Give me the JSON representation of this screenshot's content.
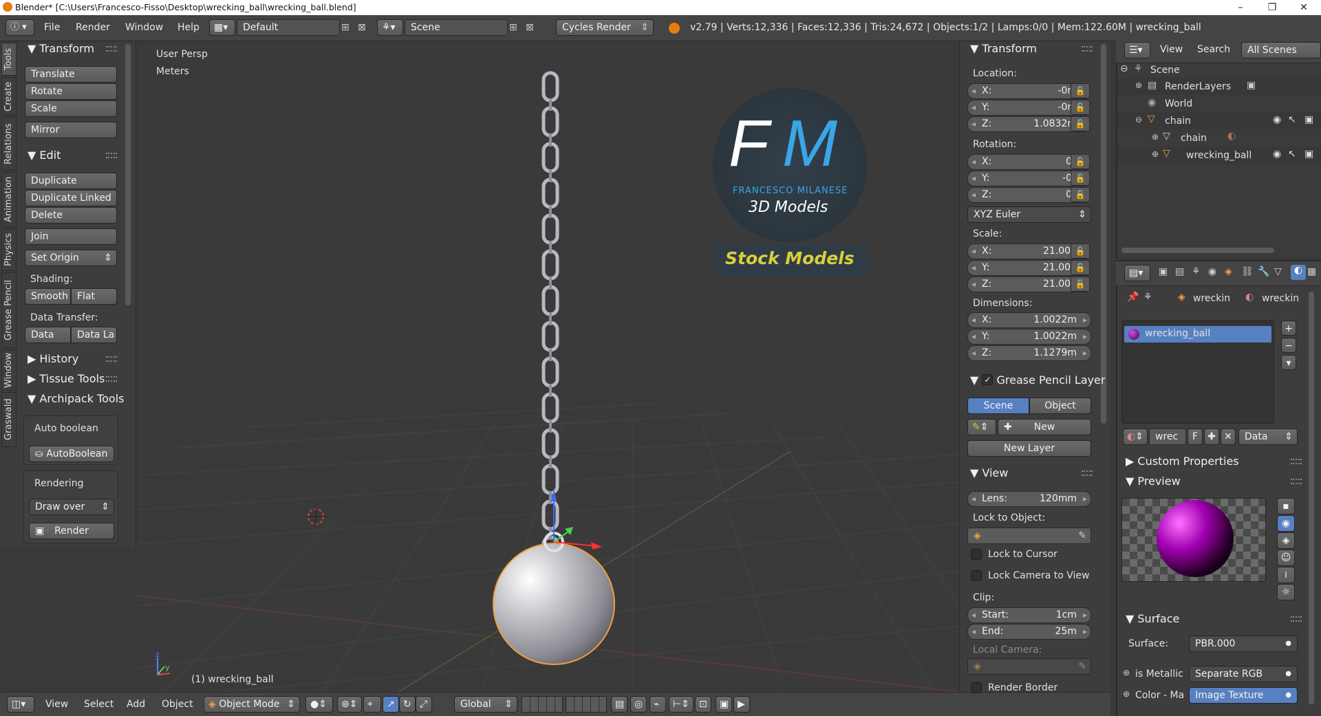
{
  "window": {
    "title": "Blender* [C:\\Users\\Francesco-Fisso\\Desktop\\wrecking_ball\\wrecking_ball.blend]",
    "minimize": "–",
    "maximize": "❐",
    "close": "✕"
  },
  "menubar": {
    "items": [
      "File",
      "Render",
      "Window",
      "Help"
    ],
    "screen_layout": "Default",
    "scene": "Scene",
    "engine": "Cycles Render",
    "stats": "v2.79 | Verts:12,336 | Faces:12,336 | Tris:24,672 | Objects:1/2 | Lamps:0/0 | Mem:122.60M | wrecking_ball"
  },
  "toolshelf": {
    "tabs": [
      "Tools",
      "Create",
      "Relations",
      "Animation",
      "Physics",
      "Grease Pencil",
      "Window",
      "Graswald"
    ],
    "transform": {
      "title": "Transform",
      "buttons": [
        "Translate",
        "Rotate",
        "Scale",
        "Mirror"
      ]
    },
    "edit": {
      "title": "Edit",
      "buttons": [
        "Duplicate",
        "Duplicate Linked",
        "Delete",
        "Join"
      ],
      "set_origin": "Set Origin"
    },
    "shading": {
      "label": "Shading:",
      "smooth": "Smooth",
      "flat": "Flat"
    },
    "data_transfer": {
      "label": "Data Transfer:",
      "data": "Data",
      "data_layout": "Data La"
    },
    "history": "History",
    "tissue": "Tissue Tools",
    "archipack": "Archipack Tools",
    "auto_boolean_label": "Auto boolean",
    "auto_boolean_btn": "AutoBoolean",
    "rendering_label": "Rendering",
    "draw_over": "Draw over",
    "render_btn": "Render"
  },
  "viewport": {
    "view_name": "User Persp",
    "units": "Meters",
    "object_label": "(1) wrecking_ball",
    "axis_y": "y",
    "axis_z": "z",
    "watermark": {
      "initials_f": "F",
      "initials_m": "M",
      "name": "FRANCESCO MILANESE",
      "sub": "3D Models",
      "banner": "Stock Models"
    }
  },
  "view3d_header": {
    "menus": [
      "View",
      "Select",
      "Add",
      "Object"
    ],
    "mode": "Object Mode",
    "orientation": "Global"
  },
  "properties_n": {
    "transform_title": "Transform",
    "location_label": "Location:",
    "location": {
      "x": "-0m",
      "y": "-0m",
      "z": "1.0832m"
    },
    "rotation_label": "Rotation:",
    "rotation": {
      "x": "0°",
      "y": "-0°",
      "z": "0°"
    },
    "rotation_mode": "XYZ Euler",
    "scale_label": "Scale:",
    "scale": {
      "x": "21.000",
      "y": "21.000",
      "z": "21.000"
    },
    "dimensions_label": "Dimensions:",
    "dimensions": {
      "x": "1.0022m",
      "y": "1.0022m",
      "z": "1.1279m"
    },
    "axis_x": "X:",
    "axis_y": "Y:",
    "axis_z": "Z:",
    "grease_pencil_title": "Grease Pencil Layer",
    "gp_scene": "Scene",
    "gp_object": "Object",
    "gp_new": "New",
    "gp_new_layer": "New Layer",
    "view_title": "View",
    "lens_label": "Lens:",
    "lens_value": "120mm",
    "lock_object_label": "Lock to Object:",
    "lock_cursor": "Lock to Cursor",
    "lock_camera": "Lock Camera to View",
    "clip_label": "Clip:",
    "clip_start_label": "Start:",
    "clip_start": "1cm",
    "clip_end_label": "End:",
    "clip_end": "25m",
    "local_camera": "Local Camera:",
    "render_border": "Render Border"
  },
  "outliner": {
    "view": "View",
    "search": "Search",
    "scope": "All Scenes",
    "items": [
      {
        "label": "Scene"
      },
      {
        "label": "RenderLayers"
      },
      {
        "label": "World"
      },
      {
        "label": "chain"
      },
      {
        "label": "chain"
      },
      {
        "label": "wrecking_ball"
      }
    ]
  },
  "material": {
    "crumb_object": "wreckin",
    "crumb_material": "wreckin",
    "slot": "wrecking_ball",
    "mat_short": "wrec",
    "fake": "F",
    "link": "Data",
    "custom_props": "Custom Properties",
    "preview": "Preview",
    "surface_title": "Surface",
    "surface_label": "Surface:",
    "surface_value": "PBR.000",
    "metallic_label": "is Metallic",
    "metallic_value": "Separate RGB",
    "color_label": "Color - Ma",
    "color_value": "Image Texture"
  },
  "colors": {
    "accent": "#5680c2",
    "header_bg": "#444444",
    "panel_bg": "#3d3d3d",
    "viewport_bg": "#393939",
    "watermark_yellow": "#d9cf3a",
    "watermark_blue": "#3aa6e8"
  }
}
